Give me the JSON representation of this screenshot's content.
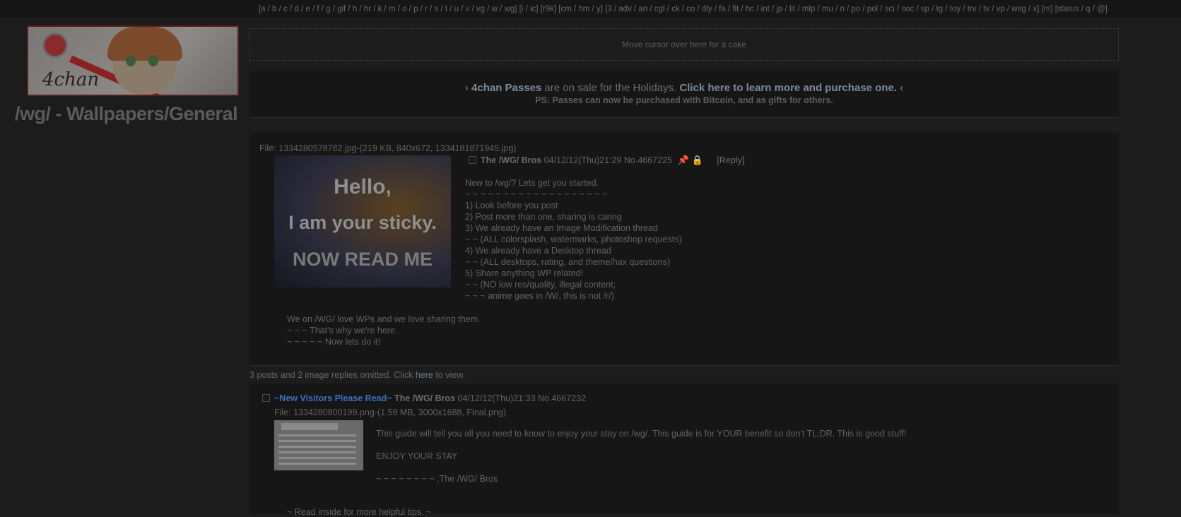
{
  "topnav": {
    "groups": [
      "[a / b / c / d / e / f / g / gif / h / hr / k / m / o / p / r / s / t / u / v / vg / w / wg]",
      "[i / ic]",
      "[r9k]",
      "[cm / hm / y]",
      "[3 / adv / an / cgl / ck / co / diy / fa / fit / hc / int / jp / lit / mlp / mu / n / po / pol / sci / soc / sp / tg / toy / trv / tv / vp / wsg / x]",
      "[rs]",
      "[status / q / @]"
    ]
  },
  "banner": {
    "logo_text": "4chan"
  },
  "board": {
    "title": "/wg/ - Wallpapers/General"
  },
  "cake": {
    "text": "Move cursor over here for a cake"
  },
  "passes": {
    "arrow_left": "›",
    "link1": "4chan Passes",
    "middle": " are on sale for the Holidays. ",
    "link2": "Click here to learn more and purchase one.",
    "arrow_right": "‹",
    "line2": "PS: Passes can now be purchased with Bitcoin, and as gifts for others."
  },
  "op": {
    "file_info": "File: 1334280578782.jpg-(219 KB, 840x672, 1334181871945.jpg)",
    "thumb_lines": [
      "Hello,",
      "I am your sticky.",
      "NOW READ ME"
    ],
    "name": "The /WG/ Bros",
    "datetime": "04/12/12(Thu)21:29",
    "post_no": "No.4667225",
    "reply_label": "[Reply]",
    "body": [
      "New to /wg/? Lets get you started.",
      "~ ~ ~ ~ ~ ~ ~ ~ ~ ~ ~ ~ ~ ~ ~ ~ ~ ~ ~",
      "1) Look before you post",
      "2) Post more than one, sharing is caring",
      "3) We already have an Image Modification thread",
      "~ ~ (ALL colorsplash, watermarks, photoshop requests)",
      "4) We already have a Desktop thread",
      "~ ~ (ALL desktops, rating, and theme/hax questions)",
      "5) Share anything WP related!",
      "~ ~ (NO low res/quality, illegal content;",
      "~ ~ ~ anime goes in /W/, this is not /r/)"
    ],
    "body2": [
      "We on /WG/ love WPs and we love sharing them.",
      "~ ~ ~ That's why we're here.",
      "~ ~ ~ ~ ~ Now lets do it!"
    ]
  },
  "omitted": {
    "prefix": "3 posts and 2 image replies omitted. Click ",
    "link": "here",
    "suffix": " to view."
  },
  "reply": {
    "subject": "~New Visitors Please Read~",
    "name": "The /WG/ Bros",
    "datetime": "04/12/12(Thu)21:33",
    "post_no": "No.4667232",
    "file_info": "File: 1334280800199.png-(1.59 MB, 3000x1688, Final.png)",
    "body": [
      "This guide will tell you all you need to know to enjoy your stay on /wg/. This guide is for YOUR benefit so don't TL;DR. This is good stuff!",
      "ENJOY YOUR STAY",
      "~ ~ ~ ~ ~ ~ ~ ~ ,The /WG/ Bros"
    ],
    "bottom": "~ Read inside for more helpful tips. ~"
  }
}
